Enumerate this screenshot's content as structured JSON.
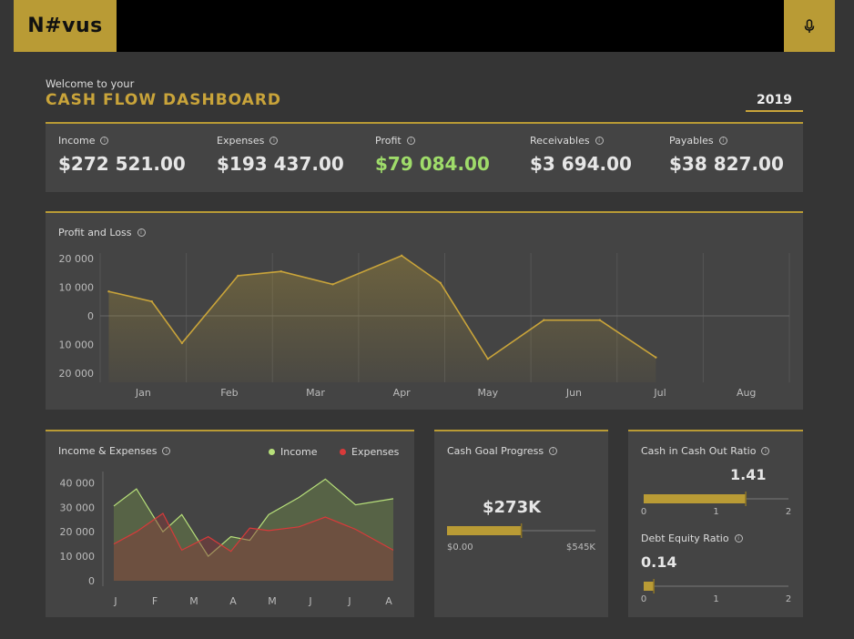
{
  "header": {
    "logo": "N#vus",
    "mic_icon": "microphone-icon"
  },
  "welcome": "Welcome to your",
  "title": "CASH FLOW DASHBOARD",
  "year": "2019",
  "kpis": [
    {
      "label": "Income",
      "value": "$272 521.00"
    },
    {
      "label": "Expenses",
      "value": "$193 437.00"
    },
    {
      "label": "Profit",
      "value": "$79 084.00"
    },
    {
      "label": "Receivables",
      "value": "$3 694.00"
    },
    {
      "label": "Payables",
      "value": "$38 827.00"
    }
  ],
  "colors": {
    "accent": "#c9a43a",
    "income": "#b7e07a",
    "expenses": "#d83a3a",
    "profit": "#9fdc6a"
  },
  "pl": {
    "title": "Profit and Loss"
  },
  "ie": {
    "title": "Income & Expenses",
    "legend_income": "Income",
    "legend_expenses": "Expenses"
  },
  "cash_goal": {
    "title": "Cash Goal Progress",
    "value": "$273K",
    "min": "$0.00",
    "max": "$545K"
  },
  "ratio1": {
    "title": "Cash in Cash Out Ratio",
    "value": "1.41",
    "ticks": [
      "0",
      "1",
      "2"
    ]
  },
  "ratio2": {
    "title": "Debt Equity Ratio",
    "value": "0.14",
    "ticks": [
      "0",
      "1",
      "2"
    ]
  },
  "chart_data": [
    {
      "type": "area",
      "title": "Profit and Loss",
      "categories": [
        "Jan",
        "Feb",
        "Mar",
        "Apr",
        "May",
        "Jun",
        "Jul",
        "Aug"
      ],
      "x": [
        0.1,
        0.6,
        0.95,
        1.6,
        2.1,
        2.7,
        3.5,
        3.95,
        4.5,
        5.15,
        5.8,
        6.45
      ],
      "values": [
        8500,
        5000,
        -9500,
        14000,
        15500,
        11000,
        21000,
        11500,
        -15000,
        -1500,
        -1500,
        -14500
      ],
      "tick_labels": [
        "20 000",
        "10 000",
        "0",
        "10 000",
        "20 000"
      ],
      "ylim": [
        -20000,
        20000
      ]
    },
    {
      "type": "area",
      "title": "Income & Expenses",
      "categories": [
        "J",
        "F",
        "M",
        "A",
        "M",
        "J",
        "J",
        "A"
      ],
      "x": [
        0,
        0.6,
        1.3,
        1.8,
        2.5,
        3.1,
        3.6,
        4.1,
        4.9,
        5.6,
        6.4,
        7.4
      ],
      "series": [
        {
          "name": "Income",
          "values": [
            30500,
            37500,
            20000,
            27000,
            10000,
            18000,
            16500,
            27000,
            34000,
            41500,
            31000,
            33500
          ]
        },
        {
          "name": "Expenses",
          "values": [
            15000,
            20000,
            27500,
            12500,
            18000,
            12000,
            21500,
            20500,
            22000,
            26000,
            21000,
            12500
          ]
        }
      ],
      "tick_labels": [
        "40 000",
        "30 000",
        "20 000",
        "10 000",
        "0"
      ],
      "ylim": [
        0,
        42000
      ]
    },
    {
      "type": "bar",
      "title": "Cash Goal Progress",
      "values": [
        273
      ],
      "xlim": [
        0,
        545
      ]
    },
    {
      "type": "bar",
      "title": "Cash in Cash Out Ratio",
      "values": [
        1.41
      ],
      "xlim": [
        0,
        2
      ]
    },
    {
      "type": "bar",
      "title": "Debt Equity Ratio",
      "values": [
        0.14
      ],
      "xlim": [
        0,
        2
      ]
    }
  ]
}
